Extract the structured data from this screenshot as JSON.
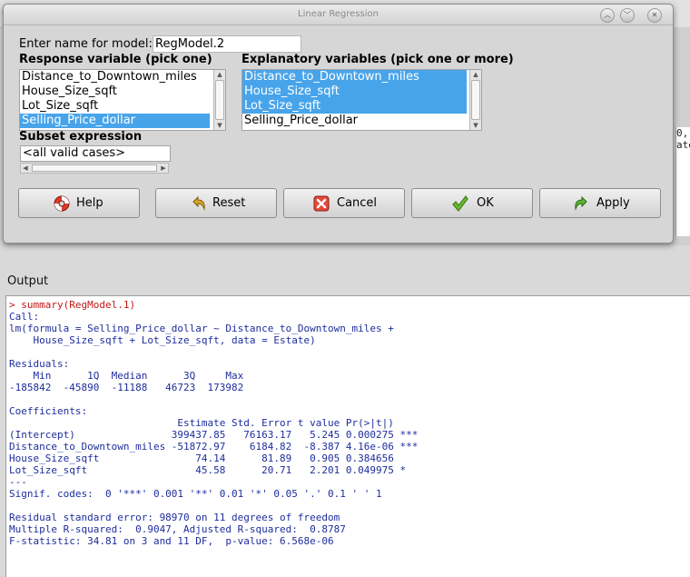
{
  "dialog": {
    "title": "Linear Regression",
    "model_label": "Enter name for model:",
    "model_value": "RegModel.2",
    "response_heading": "Response variable (pick one)",
    "explanatory_heading": "Explanatory variables (pick one or more)",
    "response_items": [
      {
        "label": "Distance_to_Downtown_miles",
        "selected": false
      },
      {
        "label": "House_Size_sqft",
        "selected": false
      },
      {
        "label": "Lot_Size_sqft",
        "selected": false
      },
      {
        "label": "Selling_Price_dollar",
        "selected": true
      }
    ],
    "explanatory_items": [
      {
        "label": "Distance_to_Downtown_miles",
        "selected": true
      },
      {
        "label": "House_Size_sqft",
        "selected": true
      },
      {
        "label": "Lot_Size_sqft",
        "selected": true
      },
      {
        "label": "Selling_Price_dollar",
        "selected": false
      }
    ],
    "subset_heading": "Subset expression",
    "subset_value": "<all valid cases>",
    "buttons": {
      "help": "Help",
      "reset": "Reset",
      "cancel": "Cancel",
      "ok": "OK",
      "apply": "Apply"
    }
  },
  "background": {
    "script_fragment": [
      "0,.",
      "ate)"
    ]
  },
  "output": {
    "label": "Output",
    "command": "> summary(RegModel.1)",
    "result": "\nCall:\nlm(formula = Selling_Price_dollar ~ Distance_to_Downtown_miles +\n    House_Size_sqft + Lot_Size_sqft, data = Estate)\n\nResiduals:\n    Min      1Q  Median      3Q     Max\n-185842  -45890  -11188   46723  173982\n\nCoefficients:\n                            Estimate Std. Error t value Pr(>|t|)\n(Intercept)                399437.85   76163.17   5.245 0.000275 ***\nDistance_to_Downtown_miles -51872.97    6184.82  -8.387 4.16e-06 ***\nHouse_Size_sqft                74.14      81.89   0.905 0.384656\nLot_Size_sqft                  45.58      20.71   2.201 0.049975 *\n---\nSignif. codes:  0 '***' 0.001 '**' 0.01 '*' 0.05 '.' 0.1 ' ' 1\n\nResidual standard error: 98970 on 11 degrees of freedom\nMultiple R-squared:  0.9047, Adjusted R-squared:  0.8787\nF-statistic: 34.81 on 3 and 11 DF,  p-value: 6.568e-06"
  },
  "colors": {
    "selection": "#48a4ea",
    "command_text": "#c41616",
    "output_text": "#1e2d9c"
  }
}
